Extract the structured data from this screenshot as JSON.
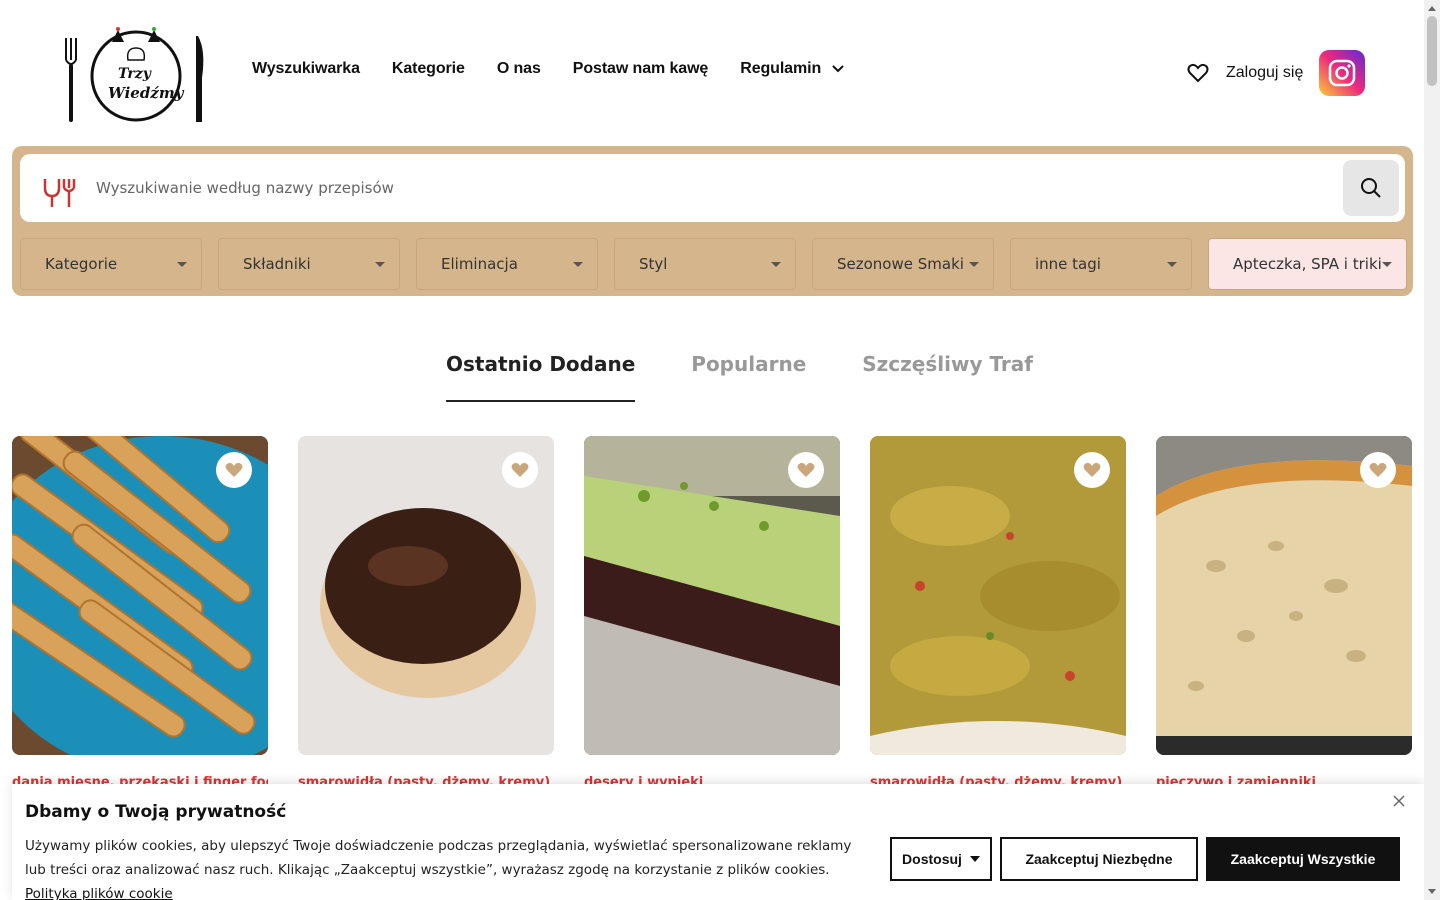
{
  "header": {
    "logo_text": [
      "Trzy",
      "Wiedźmy"
    ],
    "nav": [
      {
        "label": "Wyszukiwarka"
      },
      {
        "label": "Kategorie"
      },
      {
        "label": "O nas"
      },
      {
        "label": "Postaw nam kawę"
      },
      {
        "label": "Regulamin"
      }
    ],
    "login_label": "Zaloguj się"
  },
  "search": {
    "placeholder": "Wyszukiwanie według nazwy przepisów",
    "filters": [
      {
        "label": "Kategorie"
      },
      {
        "label": "Składniki"
      },
      {
        "label": "Eliminacja"
      },
      {
        "label": "Styl"
      },
      {
        "label": "Sezonowe Smaki"
      },
      {
        "label": "inne tagi"
      },
      {
        "label": "Apteczka, SPA i triki"
      }
    ]
  },
  "tabs": [
    {
      "label": "Ostatnio Dodane",
      "active": true
    },
    {
      "label": "Popularne",
      "active": false
    },
    {
      "label": "Szczęśliwy Traf",
      "active": false
    }
  ],
  "cards": [
    {
      "category": "dania mięsne, przekąski i finger food"
    },
    {
      "category": "smarowidła (pasty, dżemy, kremy)"
    },
    {
      "category": "desery i wypieki"
    },
    {
      "category": "smarowidła (pasty, dżemy, kremy)"
    },
    {
      "category": "pieczywo i zamienniki"
    }
  ],
  "cookie": {
    "title": "Dbamy o Twoją prywatność",
    "text": "Używamy plików cookies, aby ulepszyć Twoje doświadczenie podczas przeglądania, wyświetlać spersonalizowane reklamy lub treści oraz analizować nasz ruch. Klikając „Zaakceptuj wszystkie”, wyrażasz zgodę na korzystanie z plików cookies.",
    "policy_link": "Polityka plików cookie",
    "customize_label": "Dostosuj",
    "necessary_label": "Zaakceptuj Niezbędne",
    "accept_all_label": "Zaakceptuj Wszystkie"
  },
  "colors": {
    "search_bg": "#d5b68c",
    "pink_filter": "#fbe5e5",
    "category_red": "#dd3333",
    "heart_tan": "#c9a77b"
  }
}
